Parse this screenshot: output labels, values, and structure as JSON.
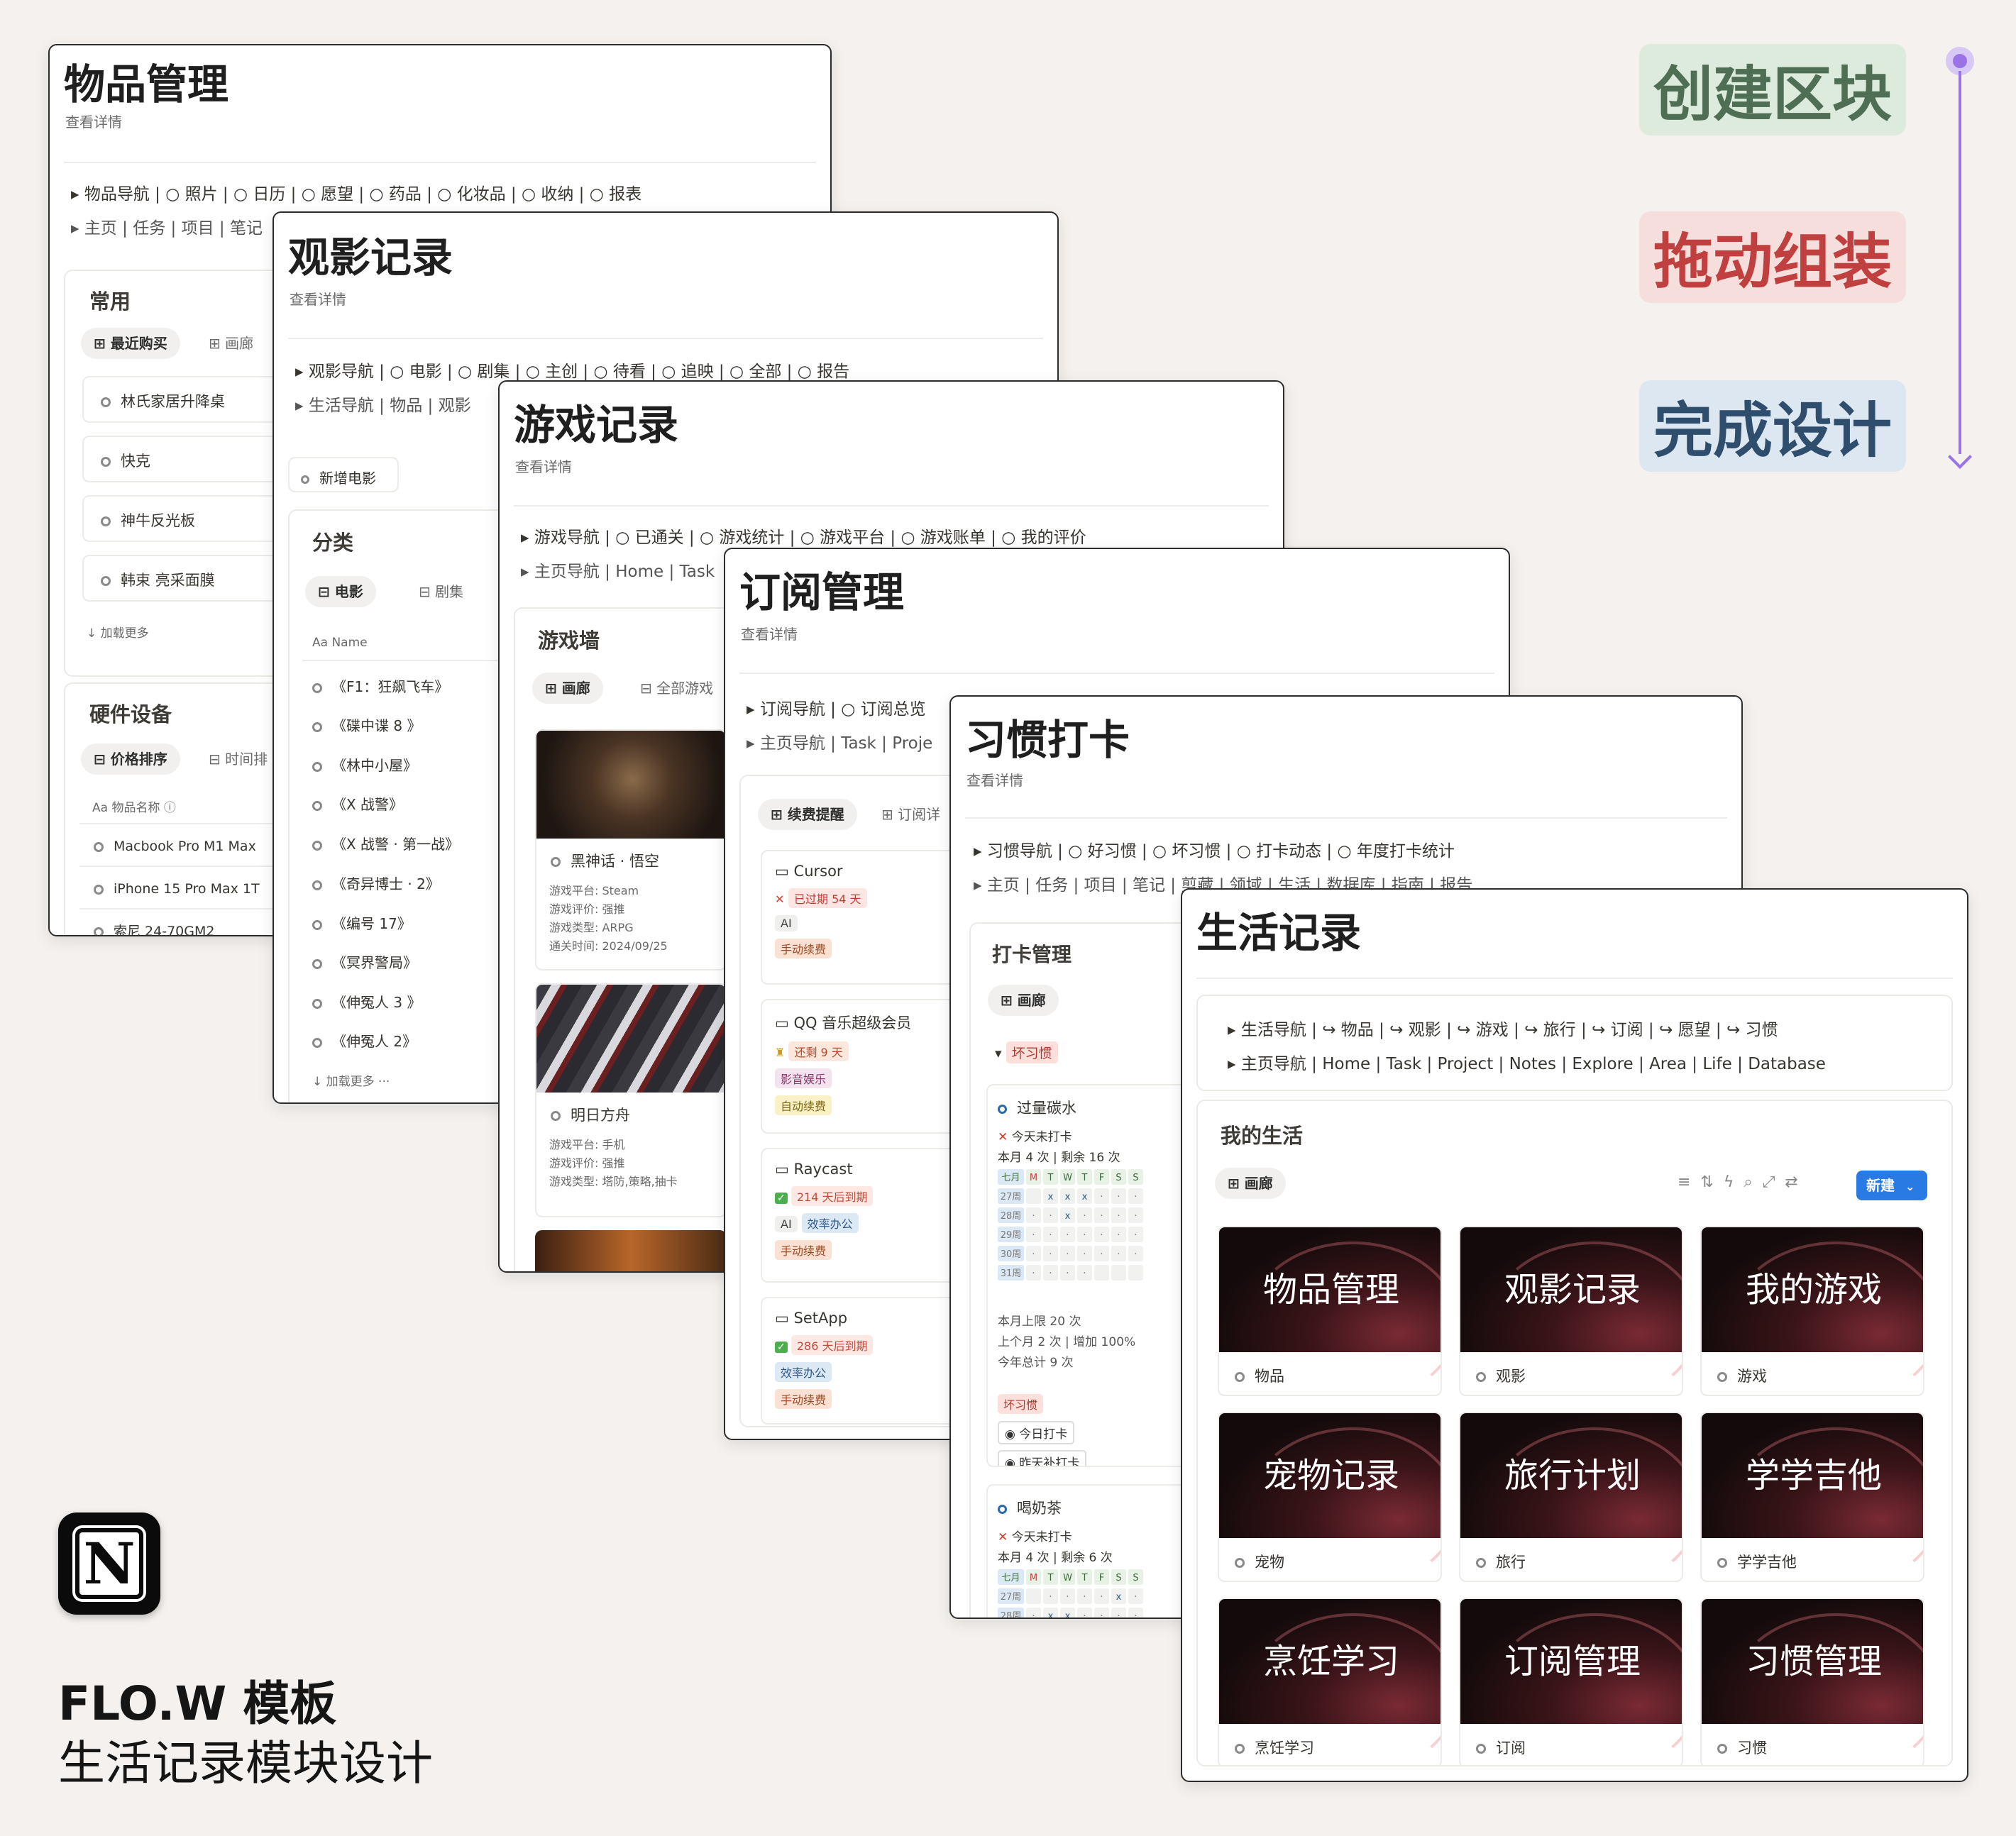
{
  "steps": {
    "s1": "创建区块",
    "s2": "拖动组装",
    "s3": "完成设计"
  },
  "footer": {
    "line1": "FLO.W 模板",
    "line2": "生活记录模块设计"
  },
  "p1": {
    "title": "物品管理",
    "sub": "查看详情",
    "nav1": "▸  物品导航 | ○ 照片 | ○ 日历 | ○ 愿望 | ○ 药品 | ○ 化妆品 | ○ 收纳 | ○ 报表",
    "nav2": "▸  主页 | 任务 | 项目 | 笔记",
    "sec1": "常用",
    "pill1": "最近购买",
    "tab1": "画廊",
    "items": [
      "林氏家居升降桌",
      "快克",
      "神牛反光板",
      "韩束 亮采面膜"
    ],
    "more": "↓ 加载更多",
    "sec2": "硬件设备",
    "pill2": "价格排序",
    "tab2": "时间排",
    "col": "Aa  物品名称 ⓘ",
    "rows": [
      "Macbook Pro M1 Max",
      "iPhone 15 Pro Max 1T",
      "索尼 24-70GM2"
    ]
  },
  "p2": {
    "title": "观影记录",
    "sub": "查看详情",
    "nav1": "▸  观影导航 | ○ 电影 | ○ 剧集 | ○ 主创 | ○ 待看 | ○ 追映 | ○ 全部 | ○ 报告",
    "nav2": "▸  生活导航 | 物品 | 观影",
    "btn": "新增电影",
    "sec": "分类",
    "pill": "电影",
    "tab": "剧集",
    "col": "Aa  Name",
    "rows": [
      "《F1：狂飙飞车》",
      "《碟中谍 8 》",
      "《林中小屋》",
      "《X 战警》",
      "《X 战警 · 第一战》",
      "《奇异博士 · 2》",
      "《编号 17》",
      "《冥界警局》",
      "《伸冤人 3 》",
      "《伸冤人 2》"
    ],
    "more": "↓ 加载更多 ···"
  },
  "p3": {
    "title": "游戏记录",
    "sub": "查看详情",
    "nav1": "▸  游戏导航 | ○ 已通关 | ○ 游戏统计 | ○ 游戏平台 | ○ 游戏账单 | ○ 我的评价",
    "nav2": "▸  主页导航 | Home | Task",
    "sec": "游戏墙",
    "pill": "画廊",
    "tab": "全部游戏",
    "g1": {
      "name": "黑神话 · 悟空",
      "l1": "游戏平台:  Steam",
      "l2": "游戏评价:  强推",
      "l3": "游戏类型:  ARPG",
      "l4": "通关时间:  2024/09/25"
    },
    "g2": {
      "name": "明日方舟",
      "l1": "游戏平台:  手机",
      "l2": "游戏评价:  强推",
      "l3": "游戏类型:  塔防,策略,抽卡"
    }
  },
  "p4": {
    "title": "订阅管理",
    "sub": "查看详情",
    "nav1": "▸  订阅导航 | ○ 订阅总览",
    "nav2": "▸  主页导航 | Task | Proje",
    "pill": "续费提醒",
    "tab": "订阅详",
    "c1": {
      "name": "Cursor",
      "status": "已过期  54  天",
      "t1": "AI",
      "t2": "手动续费"
    },
    "c2": {
      "name": "QQ 音乐超级会员",
      "status": "还剩  9  天",
      "t1": "影音娱乐",
      "t2": "自动续费"
    },
    "c3": {
      "name": "Raycast",
      "status": "214  天后到期",
      "t1": "AI",
      "t1b": "效率办公",
      "t2": "手动续费"
    },
    "c4": {
      "name": "SetApp",
      "status": "286  天后到期",
      "t1": "效率办公",
      "t2": "手动续费"
    }
  },
  "p5": {
    "title": "习惯打卡",
    "sub": "查看详情",
    "nav1": "▸  习惯导航 | ○ 好习惯 | ○ 坏习惯 | ○ 打卡动态 | ○ 年度打卡统计",
    "nav2": "▸  主页 | 任务 | 项目 | 笔记 | 剪藏 | 领域 | 生活 | 数据库 | 指南 | 报告",
    "sec": "打卡管理",
    "pill": "画廊",
    "group": "坏习惯",
    "h1": {
      "name": "过量碳水",
      "today": "今天未打卡",
      "month": "本月 4 次 | 剩余 16 次",
      "head": [
        "七月",
        "M",
        "T",
        "W",
        "T",
        "F",
        "S",
        "S"
      ],
      "weeks": [
        "27周",
        "28周",
        "29周",
        "30周",
        "31周"
      ],
      "stat1": "本月上限 20 次",
      "stat2": "上个月 2 次 | 增加 100%",
      "stat3": "今年总计 9 次",
      "tag": "坏习惯",
      "b1": "今日打卡",
      "b2": "昨天补打卡"
    },
    "h2": {
      "name": "喝奶茶",
      "today": "今天未打卡",
      "month": "本月 4 次 | 剩余 6 次",
      "weeks": [
        "27周",
        "28周"
      ]
    }
  },
  "p6": {
    "title": "生活记录",
    "nav1": "▸  生活导航 | ↪ 物品 | ↪ 观影 | ↪ 游戏 | ↪ 旅行 | ↪ 订阅 | ↪ 愿望 | ↪ 习惯",
    "nav2": "▸  主页导航 | Home | Task | Project | Notes | Explore | Area | Life | Database",
    "sec": "我的生活",
    "pill": "画廊",
    "new": "新建",
    "cards": [
      {
        "img": "物品管理",
        "label": "物品"
      },
      {
        "img": "观影记录",
        "label": "观影"
      },
      {
        "img": "我的游戏",
        "label": "游戏"
      },
      {
        "img": "宠物记录",
        "label": "宠物"
      },
      {
        "img": "旅行计划",
        "label": "旅行"
      },
      {
        "img": "学学吉他",
        "label": "学学吉他"
      },
      {
        "img": "烹饪学习",
        "label": "烹饪学习"
      },
      {
        "img": "订阅管理",
        "label": "订阅"
      },
      {
        "img": "习惯管理",
        "label": "习惯"
      }
    ]
  }
}
